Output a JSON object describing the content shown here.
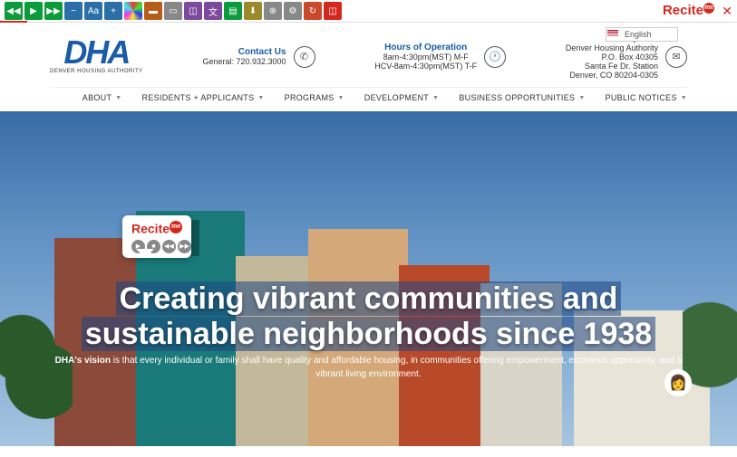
{
  "toolbar": {
    "brand_red": "Recite",
    "brand_dot": "me"
  },
  "language": {
    "selected": "English"
  },
  "logo": {
    "text": "DHA",
    "subtitle": "DENVER HOUSING AUTHORITY"
  },
  "contact": {
    "title": "Contact Us",
    "line1": "General: 720.932.3000"
  },
  "hours": {
    "title": "Hours of Operation",
    "line1": "8am-4:30pm(MST) M-F",
    "line2": "HCV-8am-4:30pm(MST) T-F"
  },
  "mail": {
    "title": "By Mail",
    "line1": "Denver Housing Authority",
    "line2": "P.O. Box 40305",
    "line3": "Santa Fe Dr. Station",
    "line4": "Denver, CO 80204-0305"
  },
  "nav": {
    "items": [
      "ABOUT",
      "RESIDENTS + APPLICANTS",
      "PROGRAMS",
      "DEVELOPMENT",
      "BUSINESS OPPORTUNITIES",
      "PUBLIC NOTICES"
    ]
  },
  "widget": {
    "brand_red": "Recite",
    "brand_dot": "me"
  },
  "hero": {
    "title_line1": "Creating vibrant communities and",
    "title_line2": "sustainable neighborhoods since 1938",
    "sub_bold": "DHA's vision",
    "sub_rest": " is that every individual or family shall have quality and affordable housing, in communities offering empowerment, economic opportunity, and a vibrant living environment."
  }
}
